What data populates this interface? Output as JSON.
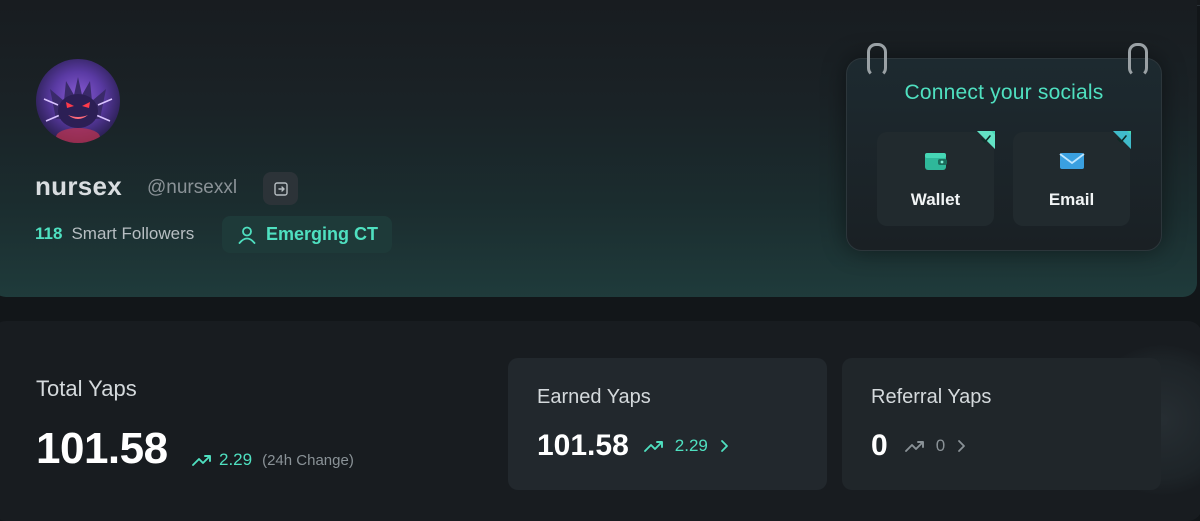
{
  "profile": {
    "display_name": "nursex",
    "handle": "@nursexxl",
    "smart_followers_count": "118",
    "smart_followers_label": "Smart Followers",
    "tier_label": "Emerging CT"
  },
  "socials": {
    "title": "Connect your socials",
    "wallet_label": "Wallet",
    "email_label": "Email"
  },
  "stats": {
    "total_title": "Total Yaps",
    "total_value": "101.58",
    "total_change": "2.29",
    "total_change_note": "(24h Change)",
    "earned_title": "Earned Yaps",
    "earned_value": "101.58",
    "earned_change": "2.29",
    "referral_title": "Referral Yaps",
    "referral_value": "0",
    "referral_change": "0"
  },
  "colors": {
    "accent": "#4fe0c0",
    "background": "#121619",
    "card": "#22282d"
  },
  "icons": {
    "logout": "logout-icon",
    "user": "user-icon",
    "wallet": "wallet-icon",
    "email": "mail-icon",
    "trend_up": "trend-up-icon",
    "chevron": "chevron-right-icon",
    "check": "check-icon"
  }
}
